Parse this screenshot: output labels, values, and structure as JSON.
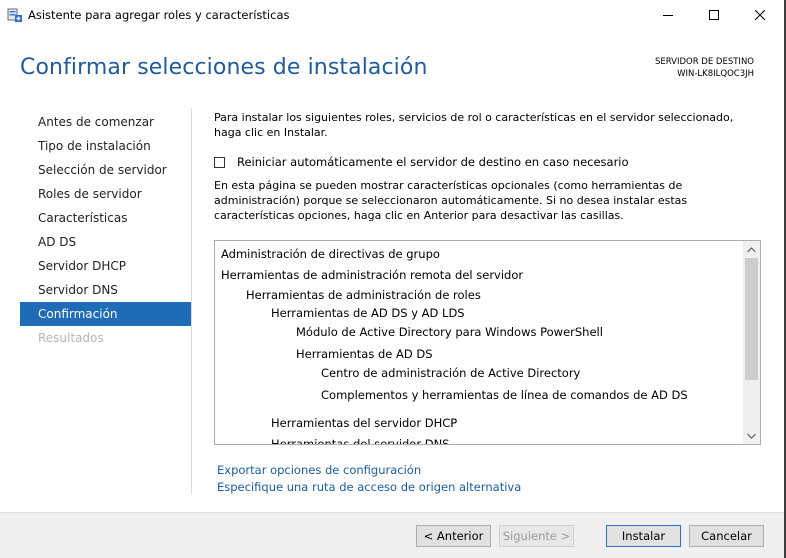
{
  "window": {
    "title": "Asistente para agregar roles y características",
    "minimize_icon": "minimize-icon",
    "maximize_icon": "maximize-icon",
    "close_icon": "close-icon"
  },
  "header": {
    "title": "Confirmar selecciones de instalación",
    "server_label": "SERVIDOR DE DESTINO",
    "server_name": "WIN-LK8ILQOC3JH"
  },
  "sidebar": {
    "items": [
      {
        "label": "Antes de comenzar",
        "state": "normal"
      },
      {
        "label": "Tipo de instalación",
        "state": "normal"
      },
      {
        "label": "Selección de servidor",
        "state": "normal"
      },
      {
        "label": "Roles de servidor",
        "state": "normal"
      },
      {
        "label": "Características",
        "state": "normal"
      },
      {
        "label": "AD DS",
        "state": "normal"
      },
      {
        "label": "Servidor DHCP",
        "state": "normal"
      },
      {
        "label": "Servidor DNS",
        "state": "normal"
      },
      {
        "label": "Confirmación",
        "state": "active"
      },
      {
        "label": "Resultados",
        "state": "disabled"
      }
    ]
  },
  "main": {
    "intro": "Para instalar los siguientes roles, servicios de rol o características en el servidor seleccionado, haga clic en Instalar.",
    "restart_checkbox": {
      "label": "Reiniciar automáticamente el servidor de destino en caso necesario",
      "checked": false
    },
    "info": "En esta página se pueden mostrar características opcionales (como herramientas de administración) porque se seleccionaron automáticamente. Si no desea instalar estas características opciones, haga clic en Anterior para desactivar las casillas.",
    "tree": [
      {
        "text": "Administración de directivas de grupo",
        "level": 0
      },
      {
        "text": "Herramientas de administración remota del servidor",
        "level": 0
      },
      {
        "text": "Herramientas de administración de roles",
        "level": 1
      },
      {
        "text": "Herramientas de AD DS y AD LDS",
        "level": 2
      },
      {
        "text": "Módulo de Active Directory para Windows PowerShell",
        "level": 3
      },
      {
        "text": "Herramientas de AD DS",
        "level": 3
      },
      {
        "text": "Centro de administración de Active Directory",
        "level": 4
      },
      {
        "text": "Complementos y herramientas de línea de comandos de AD DS",
        "level": 4
      },
      {
        "text": "Herramientas del servidor DHCP",
        "level": 2
      },
      {
        "text": "Herramientas del servidor DNS",
        "level": 2
      }
    ],
    "export_link": "Exportar opciones de configuración",
    "alt_source_link": "Especifique una ruta de acceso de origen alternativa"
  },
  "footer": {
    "back": "< Anterior",
    "next": "Siguiente >",
    "install": "Instalar",
    "cancel": "Cancelar"
  },
  "colors": {
    "accent": "#1e6bb8",
    "title": "#1f5b9e",
    "link": "#1a5ea8"
  }
}
